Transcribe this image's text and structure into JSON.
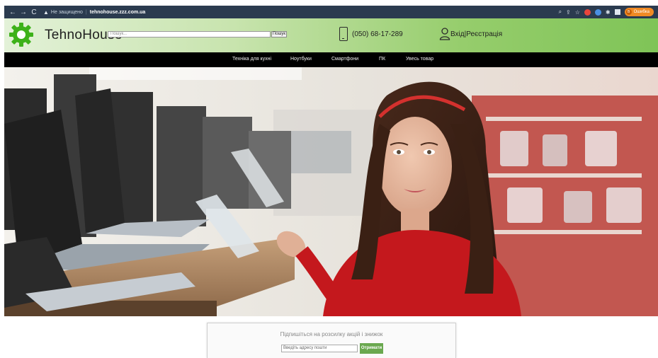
{
  "browser": {
    "security_label": "Не защищено",
    "url": "tehnohouse.zzz.com.ua",
    "profile_label": "Ошибка",
    "profile_initial": "В"
  },
  "header": {
    "logo_text": "TehnoHouse",
    "search_placeholder": "Пошук...",
    "search_button": "Пошук",
    "phone": "(050) 68-17-289",
    "login": "Вхід|Реєстрація"
  },
  "nav": {
    "items": [
      "Техніка для кухні",
      "Ноутбуки",
      "Смартфони",
      "ПК",
      "Увесь товар"
    ]
  },
  "subscribe": {
    "title": "Підпишіться на розсилку акцій і знижок",
    "email_placeholder": "Введіть адресу пошти",
    "button": "Отримати"
  },
  "colors": {
    "nav_bg": "#000000",
    "header_green": "#7fc457",
    "accent_green": "#6aa84f",
    "browser_bar": "#2b3b4f"
  }
}
